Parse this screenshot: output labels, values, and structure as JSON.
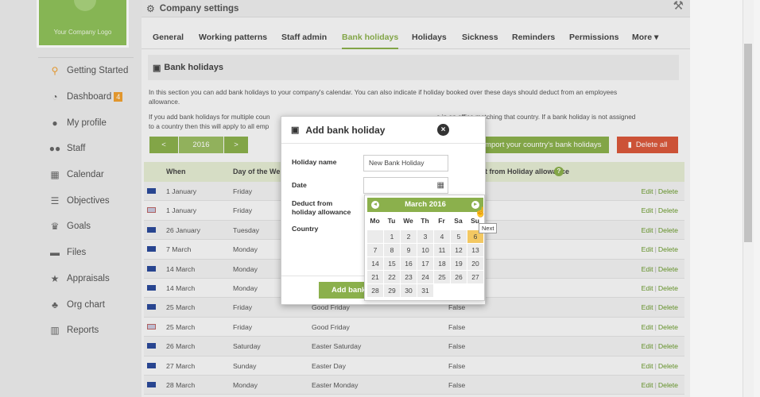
{
  "sidebar": {
    "logo_text": "Your Company Logo",
    "items": [
      {
        "label": "Getting Started",
        "icon": "map-marker-icon",
        "glyph": "⚲"
      },
      {
        "label": "Dashboard",
        "icon": "dashboard-icon",
        "glyph": "◔",
        "badge": "4"
      },
      {
        "label": "My profile",
        "icon": "user-icon",
        "glyph": "●"
      },
      {
        "label": "Staff",
        "icon": "users-icon",
        "glyph": "●●"
      },
      {
        "label": "Calendar",
        "icon": "calendar-icon",
        "glyph": "▦"
      },
      {
        "label": "Objectives",
        "icon": "list-icon",
        "glyph": "☰"
      },
      {
        "label": "Goals",
        "icon": "trophy-icon",
        "glyph": "♛"
      },
      {
        "label": "Files",
        "icon": "folder-icon",
        "glyph": "▬"
      },
      {
        "label": "Appraisals",
        "icon": "star-icon",
        "glyph": "★"
      },
      {
        "label": "Org chart",
        "icon": "sitemap-icon",
        "glyph": "♣"
      },
      {
        "label": "Reports",
        "icon": "bar-chart-icon",
        "glyph": "▥"
      }
    ]
  },
  "page": {
    "title": "Company settings"
  },
  "tabs": [
    {
      "label": "General"
    },
    {
      "label": "Working patterns"
    },
    {
      "label": "Staff admin"
    },
    {
      "label": "Bank holidays",
      "active": true
    },
    {
      "label": "Holidays"
    },
    {
      "label": "Sickness"
    },
    {
      "label": "Reminders"
    },
    {
      "label": "Permissions"
    },
    {
      "label": "More ▾"
    }
  ],
  "section": {
    "title": "Bank holidays",
    "desc1": "In this section you can add bank holidays to your company's calendar. You can also indicate if holiday booked over these days should deduct from an employees",
    "desc1b": "allowance.",
    "desc2a": "If you add bank holidays for multiple coun",
    "desc2b": "s in an office matching that country. If a bank holiday is not assigned",
    "desc2c": "to a country then this will apply to all emp"
  },
  "year_nav": {
    "prev": "<",
    "year": "2016",
    "next": ">"
  },
  "buttons": {
    "import": "Import your country's bank holidays",
    "delete_all": "Delete all"
  },
  "table": {
    "headers": {
      "when": "When",
      "day": "Day of the We",
      "deduct": "duct from Holiday allowance"
    },
    "action_edit": "Edit",
    "action_delete": "Delete",
    "rows": [
      {
        "flag": "au",
        "when": "1 January",
        "day": "Friday",
        "name": "",
        "deduct": ""
      },
      {
        "flag": "uk",
        "when": "1 January",
        "day": "Friday",
        "name": "",
        "deduct": ""
      },
      {
        "flag": "au",
        "when": "26 January",
        "day": "Tuesday",
        "name": "",
        "deduct": ""
      },
      {
        "flag": "au",
        "when": "7 March",
        "day": "Monday",
        "name": "",
        "deduct": ""
      },
      {
        "flag": "au",
        "when": "14 March",
        "day": "Monday",
        "name": "",
        "deduct": ""
      },
      {
        "flag": "au",
        "when": "14 March",
        "day": "Monday",
        "name": "",
        "deduct": ""
      },
      {
        "flag": "au",
        "when": "25 March",
        "day": "Friday",
        "name": "Good Friday",
        "deduct": "False"
      },
      {
        "flag": "uk",
        "when": "25 March",
        "day": "Friday",
        "name": "Good Friday",
        "deduct": "False"
      },
      {
        "flag": "au",
        "when": "26 March",
        "day": "Saturday",
        "name": "Easter Saturday",
        "deduct": "False"
      },
      {
        "flag": "au",
        "when": "27 March",
        "day": "Sunday",
        "name": "Easter Day",
        "deduct": "False"
      },
      {
        "flag": "au",
        "when": "28 March",
        "day": "Monday",
        "name": "Easter Monday",
        "deduct": "False"
      }
    ]
  },
  "modal": {
    "title": "Add bank holiday",
    "close": "×",
    "holiday_name_label": "Holiday name",
    "holiday_name_value": "New Bank Holiday",
    "date_label": "Date",
    "date_value": "",
    "deduct_label_1": "Deduct from",
    "deduct_label_2": "holiday allowance",
    "country_label": "Country",
    "add_button": "Add bank"
  },
  "calendar": {
    "month": "March 2016",
    "prev": "◂",
    "next": "▸",
    "tooltip": "Next",
    "dow": [
      "Mo",
      "Tu",
      "We",
      "Th",
      "Fr",
      "Sa",
      "Su"
    ],
    "weeks": [
      [
        "",
        "1",
        "2",
        "3",
        "4",
        "5",
        "6"
      ],
      [
        "7",
        "8",
        "9",
        "10",
        "11",
        "12",
        "13"
      ],
      [
        "14",
        "15",
        "16",
        "17",
        "18",
        "19",
        "20"
      ],
      [
        "21",
        "22",
        "23",
        "24",
        "25",
        "26",
        "27"
      ],
      [
        "28",
        "29",
        "30",
        "31",
        "",
        "",
        ""
      ]
    ],
    "highlight": "6"
  },
  "colors": {
    "accent": "#8bb04c",
    "danger": "#d9583b",
    "highlight": "#f3c862"
  }
}
